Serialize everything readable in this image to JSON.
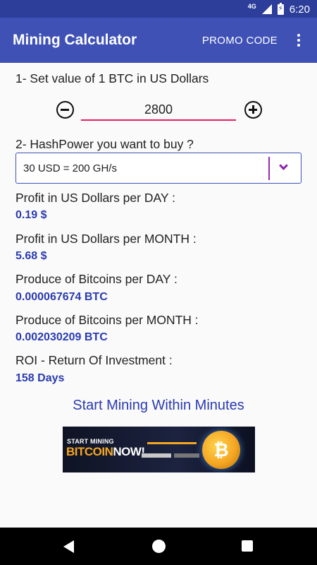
{
  "status_bar": {
    "network": "4G",
    "time": "6:20"
  },
  "app_bar": {
    "title": "Mining Calculator",
    "promo_label": "PROMO CODE"
  },
  "step1": {
    "label": "1- Set value of 1 BTC in US Dollars",
    "btc_value": "2800"
  },
  "step2": {
    "label": "2- HashPower  you want to buy ?",
    "selected_option": "30 USD = 200 GH/s"
  },
  "results": [
    {
      "label": "Profit in US Dollars per DAY :",
      "value": "0.19 $"
    },
    {
      "label": "Profit in US Dollars per MONTH :",
      "value": "5.68 $"
    },
    {
      "label": "Produce of Bitcoins per DAY :",
      "value": "0.000067674 BTC"
    },
    {
      "label": "Produce of Bitcoins per MONTH :",
      "value": "0.002030209 BTC"
    },
    {
      "label": "ROI - Return Of Investment :",
      "value": "158 Days"
    }
  ],
  "cta": "Start Mining Within Minutes",
  "banner": {
    "line1": "START MINING",
    "line2_a": "BITCOIN",
    "line2_b": "NOW!",
    "coin_symbol": "₿"
  },
  "colors": {
    "status_bar": "#2d3e9a",
    "app_bar": "#3f51b5",
    "accent": "#e91e63",
    "value_text": "#2a3bb0",
    "spinner_accent": "#9c27b0"
  }
}
